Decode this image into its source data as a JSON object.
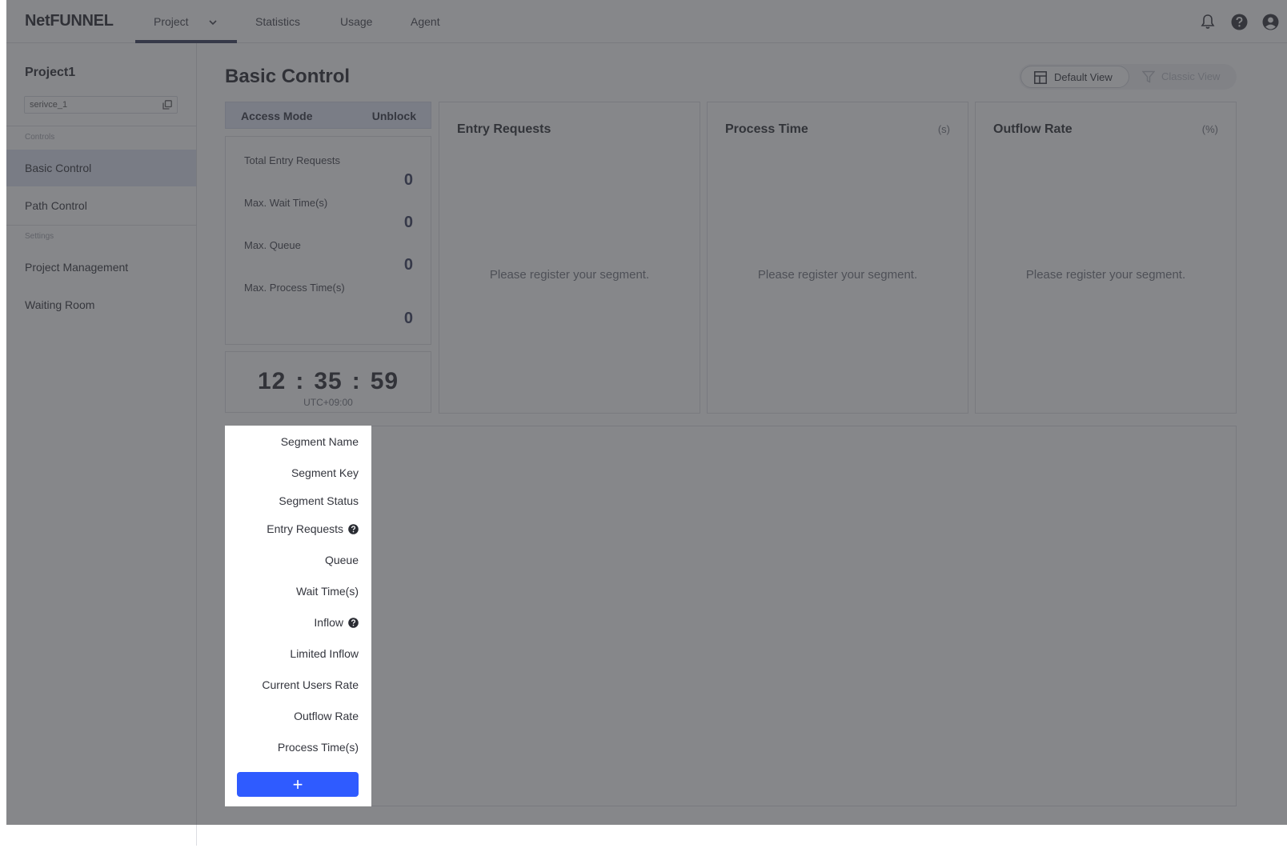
{
  "app": {
    "logo": "NetFUNNEL"
  },
  "topnav": {
    "tabs": [
      {
        "label": "Project"
      },
      {
        "label": "Statistics"
      },
      {
        "label": "Usage"
      },
      {
        "label": "Agent"
      }
    ]
  },
  "sidebar": {
    "project_name": "Project1",
    "service_id": "serivce_1",
    "sections": {
      "controls": "Controls",
      "settings": "Settings"
    },
    "items": [
      {
        "label": "Basic Control"
      },
      {
        "label": "Path Control"
      },
      {
        "label": "Project Management"
      },
      {
        "label": "Waiting Room"
      }
    ]
  },
  "main": {
    "title": "Basic Control",
    "views": {
      "default": "Default View",
      "classic": "Classic View"
    },
    "access": {
      "label": "Access Mode",
      "value": "Unblock"
    },
    "stats": [
      {
        "label": "Total Entry Requests",
        "value": "0"
      },
      {
        "label": "Max. Wait Time(s)",
        "value": "0"
      },
      {
        "label": "Max. Queue",
        "value": "0"
      },
      {
        "label": "Max. Process Time(s)",
        "value": "0"
      }
    ],
    "clock": {
      "h": "12",
      "m": "35",
      "s": "59",
      "sep": ":",
      "tz": "UTC+09:00"
    },
    "metrics": [
      {
        "title": "Entry Requests",
        "unit": "",
        "empty": "Please register your segment."
      },
      {
        "title": "Process Time",
        "unit": "(s)",
        "empty": "Please register your segment."
      },
      {
        "title": "Outflow Rate",
        "unit": "(%)",
        "empty": "Please register your segment."
      }
    ],
    "segment_fields": [
      {
        "label": "Segment Name"
      },
      {
        "label": "Segment Key"
      },
      {
        "label": "Segment Status"
      },
      {
        "label": "Entry Requests"
      },
      {
        "label": "Queue"
      },
      {
        "label": "Wait Time(s)"
      },
      {
        "label": "Inflow"
      },
      {
        "label": "Limited Inflow"
      },
      {
        "label": "Current Users Rate"
      },
      {
        "label": "Outflow Rate"
      },
      {
        "label": "Process Time(s)"
      }
    ],
    "add_label": "+"
  },
  "colors": {
    "accent": "#2f5bff",
    "nav_active": "#2f3352",
    "overlay": "#3c3e42"
  }
}
